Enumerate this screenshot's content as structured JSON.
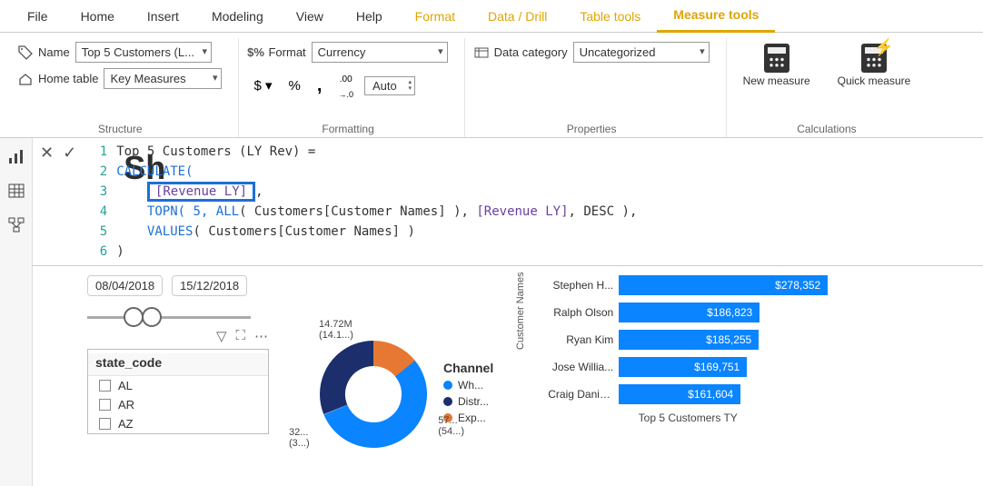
{
  "tabs": {
    "file": "File",
    "home": "Home",
    "insert": "Insert",
    "modeling": "Modeling",
    "view": "View",
    "help": "Help",
    "format": "Format",
    "data_drill": "Data / Drill",
    "table_tools": "Table tools",
    "measure_tools": "Measure tools"
  },
  "structure": {
    "name_label": "Name",
    "name_value": "Top 5 Customers (L...",
    "home_table_label": "Home table",
    "home_table_value": "Key Measures",
    "group_label": "Structure"
  },
  "formatting": {
    "format_label": "Format",
    "format_value": "Currency",
    "auto_value": "Auto",
    "currency_sym": "$",
    "percent_sym": "%",
    "comma_sym": ",",
    "dec_inc": ".00",
    "group_label": "Formatting"
  },
  "properties": {
    "category_label": "Data category",
    "category_value": "Uncategorized",
    "group_label": "Properties"
  },
  "calculations": {
    "new_measure": "New measure",
    "quick_measure": "Quick measure",
    "group_label": "Calculations"
  },
  "formula": {
    "sh_bg": "Sh",
    "l1": "Top 5 Customers (LY Rev) =",
    "l2": "CALCULATE(",
    "l3_hl": "[Revenue LY]",
    "l3_tail": ",",
    "l4a": "TOPN( 5, ",
    "l4b": "ALL",
    "l4c": "( Customers[Customer Names] ), ",
    "l4d": "[Revenue LY]",
    "l4e": ", DESC ),",
    "l5a": "VALUES",
    "l5b": "( Customers[Customer Names] )",
    "l6": ")"
  },
  "dates": {
    "start": "08/04/2018",
    "end": "15/12/2018"
  },
  "slicer": {
    "header": "state_code",
    "items": [
      "AL",
      "AR",
      "AZ"
    ]
  },
  "donut": {
    "legend_title": "Channel",
    "legend": [
      {
        "label": "Wh...",
        "color": "#0a84ff"
      },
      {
        "label": "Distr...",
        "color": "#1c2e6b"
      },
      {
        "label": "Exp...",
        "color": "#e67833"
      }
    ],
    "label_top": "14.72M",
    "label_top_sub": "(14.1...)",
    "label_left": "32...",
    "label_left_sub": "(3...)",
    "label_right": "57...",
    "label_right_sub": "(54...)"
  },
  "barchart": {
    "y_axis": "Customer Names",
    "title": "Top 5 Customers TY",
    "rows": [
      {
        "label": "Stephen H...",
        "value": "$278,352"
      },
      {
        "label": "Ralph Olson",
        "value": "$186,823"
      },
      {
        "label": "Ryan Kim",
        "value": "$185,255"
      },
      {
        "label": "Jose Willia...",
        "value": "$169,751"
      },
      {
        "label": "Craig Daniels",
        "value": "$161,604"
      }
    ]
  },
  "chart_data": [
    {
      "type": "pie",
      "title": "Channel",
      "categories": [
        "Wholesale",
        "Distributor",
        "Export"
      ],
      "values": [
        57,
        32,
        14.72
      ],
      "value_labels": [
        "57... (54...)",
        "32... (3...)",
        "14.72M (14.1...)"
      ],
      "colors": [
        "#0a84ff",
        "#1c2e6b",
        "#e67833"
      ]
    },
    {
      "type": "bar",
      "title": "Top 5 Customers TY",
      "xlabel": "",
      "ylabel": "Customer Names",
      "orientation": "horizontal",
      "categories": [
        "Stephen H...",
        "Ralph Olson",
        "Ryan Kim",
        "Jose Willia...",
        "Craig Daniels"
      ],
      "values": [
        278352,
        186823,
        185255,
        169751,
        161604
      ],
      "xlim": [
        0,
        300000
      ],
      "color": "#0a84ff"
    }
  ]
}
